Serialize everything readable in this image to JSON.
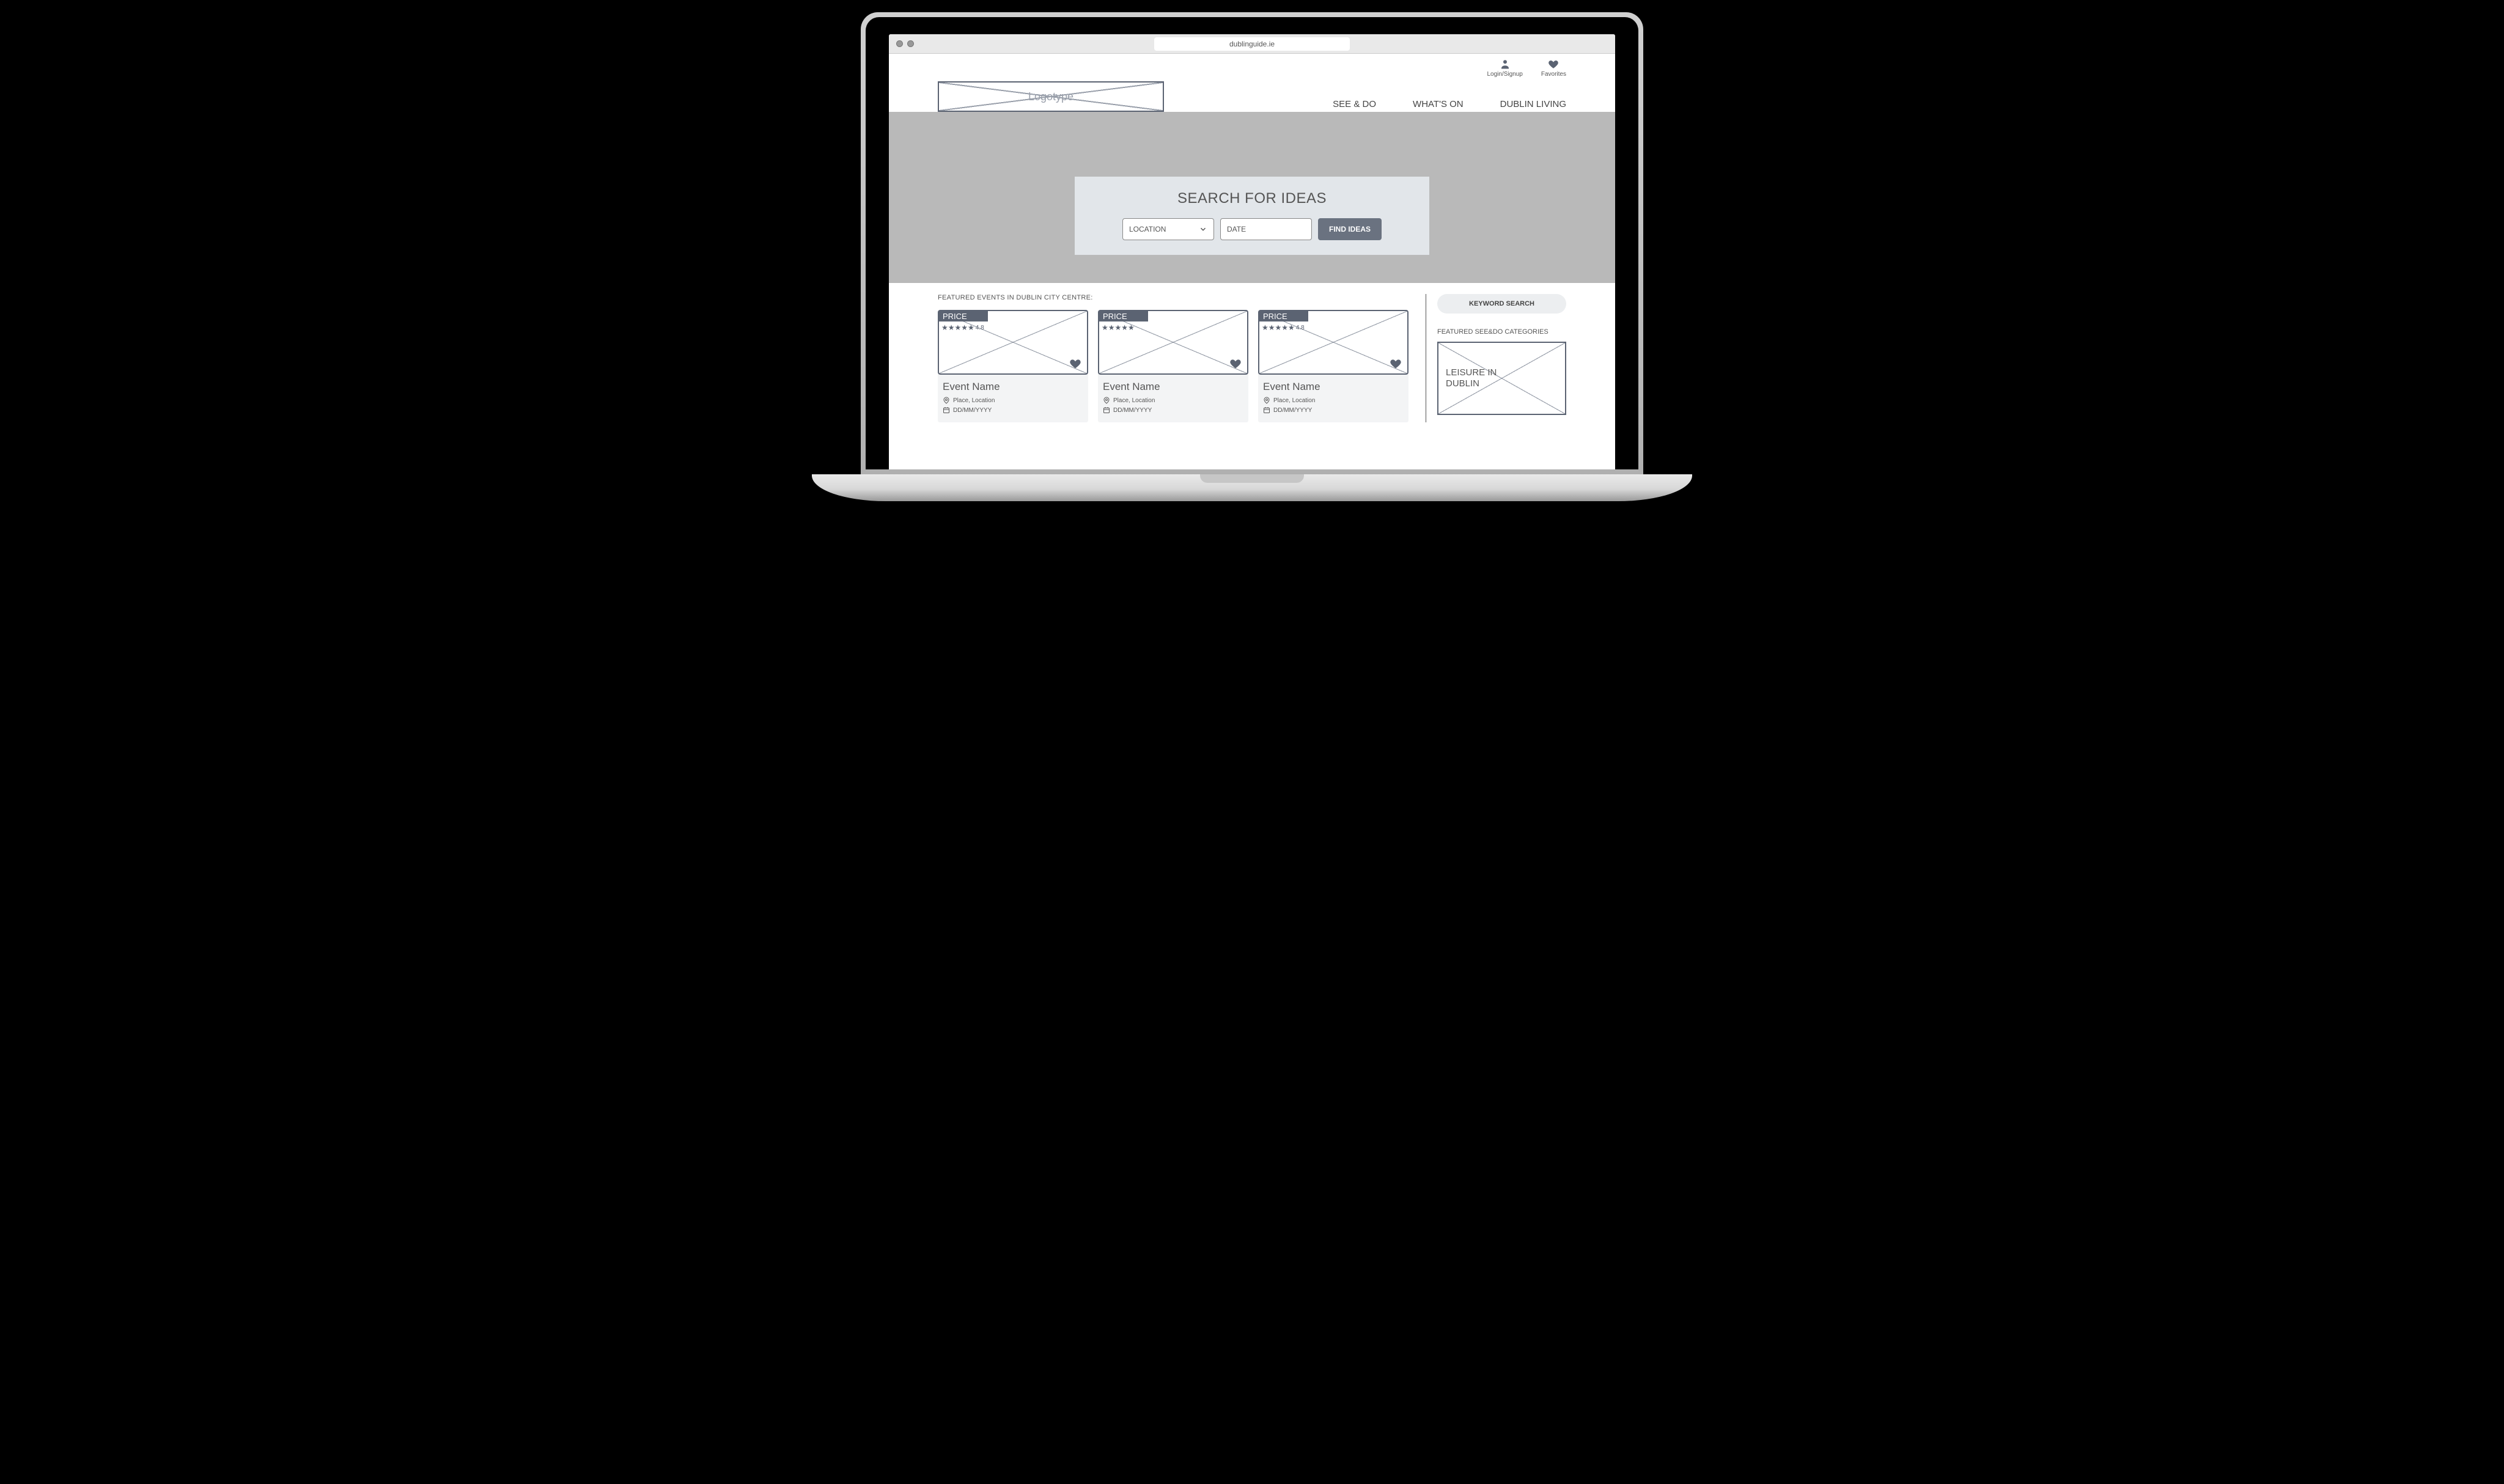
{
  "browser": {
    "url": "dublinguide.ie"
  },
  "topbar": {
    "login_label": "Login/Signup",
    "favorites_label": "Favorites"
  },
  "logo_placeholder": "Logotype",
  "nav": {
    "items": [
      {
        "label": "SEE & DO"
      },
      {
        "label": "WHAT'S ON"
      },
      {
        "label": "DUBLIN LIVING"
      }
    ]
  },
  "search": {
    "title": "SEARCH FOR IDEAS",
    "location_label": "LOCATION",
    "date_placeholder": "DATE",
    "button_label": "FIND IDEAS"
  },
  "featured_heading": "FEATURED EVENTS IN DUBLIN CITY CENTRE:",
  "cards": [
    {
      "price": "PRICE",
      "rating": "4.8",
      "title": "Event Name",
      "place": "Place, Location",
      "date": "DD/MM/YYYY"
    },
    {
      "price": "PRICE",
      "rating": "",
      "title": "Event Name",
      "place": "Place, Location",
      "date": "DD/MM/YYYY"
    },
    {
      "price": "PRICE",
      "rating": "4.8",
      "title": "Event Name",
      "place": "Place, Location",
      "date": "DD/MM/YYYY"
    }
  ],
  "sidebar": {
    "keyword_label": "KEYWORD SEARCH",
    "featured_label": "FEATURED SEE&DO CATEGORIES",
    "category_title": "LEISURE IN DUBLIN"
  }
}
